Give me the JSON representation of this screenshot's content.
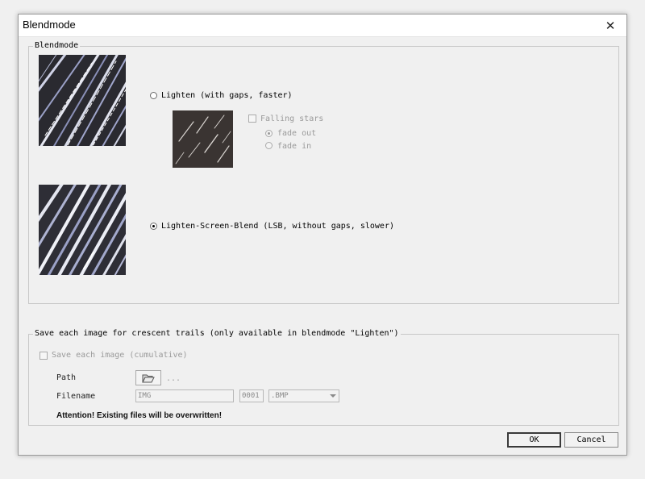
{
  "window": {
    "title": "Blendmode",
    "close_symbol": "✕"
  },
  "blendmode_group": {
    "label": "Blendmode",
    "lighten_label": "Lighten (with gaps, faster)",
    "lighten_selected": false,
    "falling_stars_label": "Falling stars",
    "falling_stars_checked": false,
    "fade_out_label": "fade out",
    "fade_out_selected": true,
    "fade_in_label": "fade in",
    "fade_in_selected": false,
    "lsb_label": "Lighten-Screen-Blend (LSB, without gaps, slower)",
    "lsb_selected": true
  },
  "save_group": {
    "label": "Save each image for crescent trails (only available in blendmode \"Lighten\")",
    "save_checkbox_label": "Save each image (cumulative)",
    "save_checked": false,
    "path_label": "Path",
    "path_value": "...",
    "filename_label": "Filename",
    "filename_prefix": "IMG",
    "filename_counter": "0001",
    "filename_ext": ".BMP",
    "attention": "Attention! Existing files will be overwritten!"
  },
  "buttons": {
    "ok": "OK",
    "cancel": "Cancel"
  },
  "icons": {
    "close": "close-icon",
    "folder": "folder-open-icon"
  }
}
